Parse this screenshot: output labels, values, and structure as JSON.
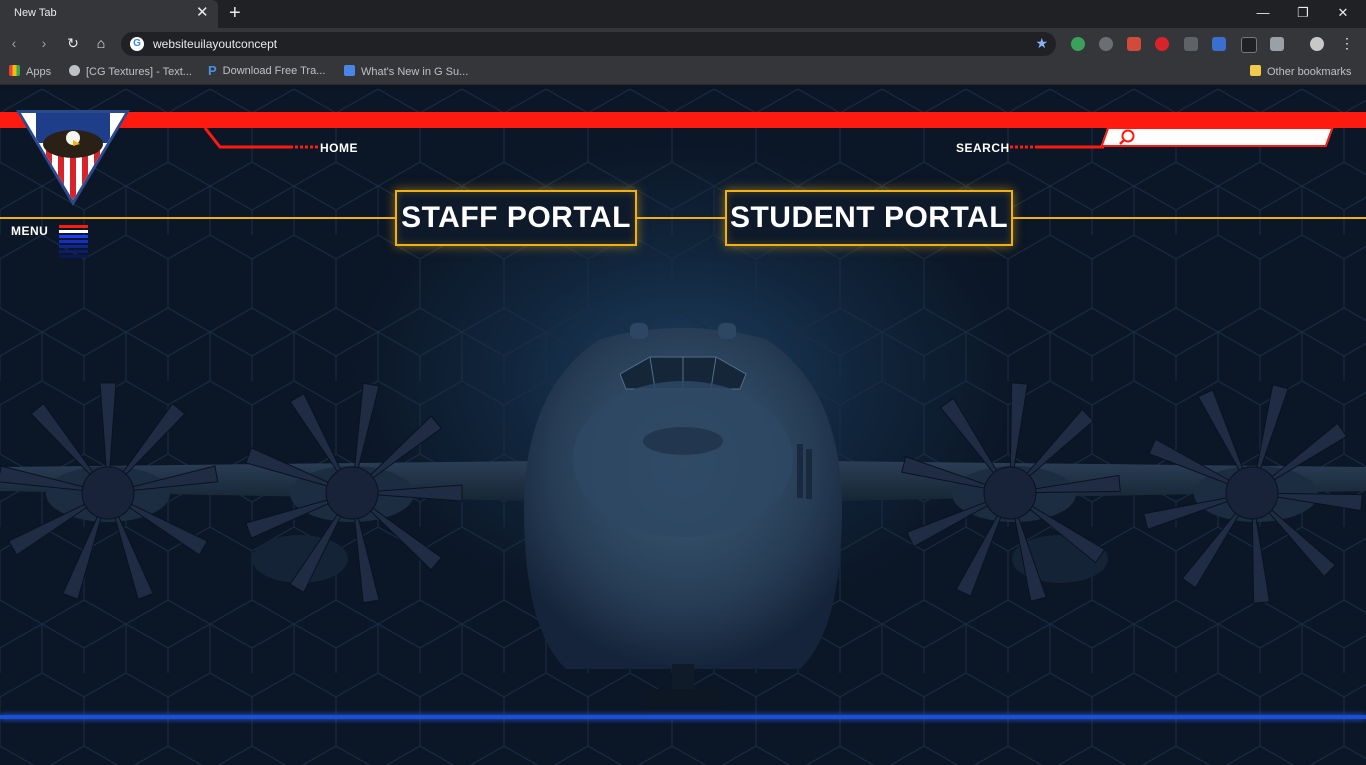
{
  "browser": {
    "tab_title": "New Tab",
    "tab_close": "✕",
    "new_tab": "+",
    "url": "websiteuilayoutconcept",
    "window_controls": {
      "minimize": "—",
      "restore": "❐",
      "close": "✕"
    },
    "bookmarks": [
      {
        "label": "Apps",
        "icon": "apps-grid-icon"
      },
      {
        "label": "[CG Textures] - Text...",
        "icon": "globe-icon"
      },
      {
        "label": "Download Free Tra...",
        "icon": "p-logo-icon"
      },
      {
        "label": "What's New in G Su...",
        "icon": "docs-icon"
      }
    ],
    "other_bookmarks": "Other bookmarks"
  },
  "site": {
    "nav": {
      "home": "HOME",
      "search": "SEARCH"
    },
    "search": {
      "value": "",
      "placeholder": ""
    },
    "portals": {
      "staff": "STAFF PORTAL",
      "student": "STUDENT PORTAL"
    },
    "menu": {
      "label": "MENU",
      "stripe_colors": [
        "#ff1a10",
        "#ffffff",
        "#1a3cff",
        "#1530c0",
        "#10268f",
        "#0c1d6b",
        "#0a1853"
      ]
    },
    "colors": {
      "accent_red": "#ff1a10",
      "accent_gold": "#f0b016",
      "accent_blue": "#1c4fd8",
      "background": "#0b1422"
    }
  }
}
